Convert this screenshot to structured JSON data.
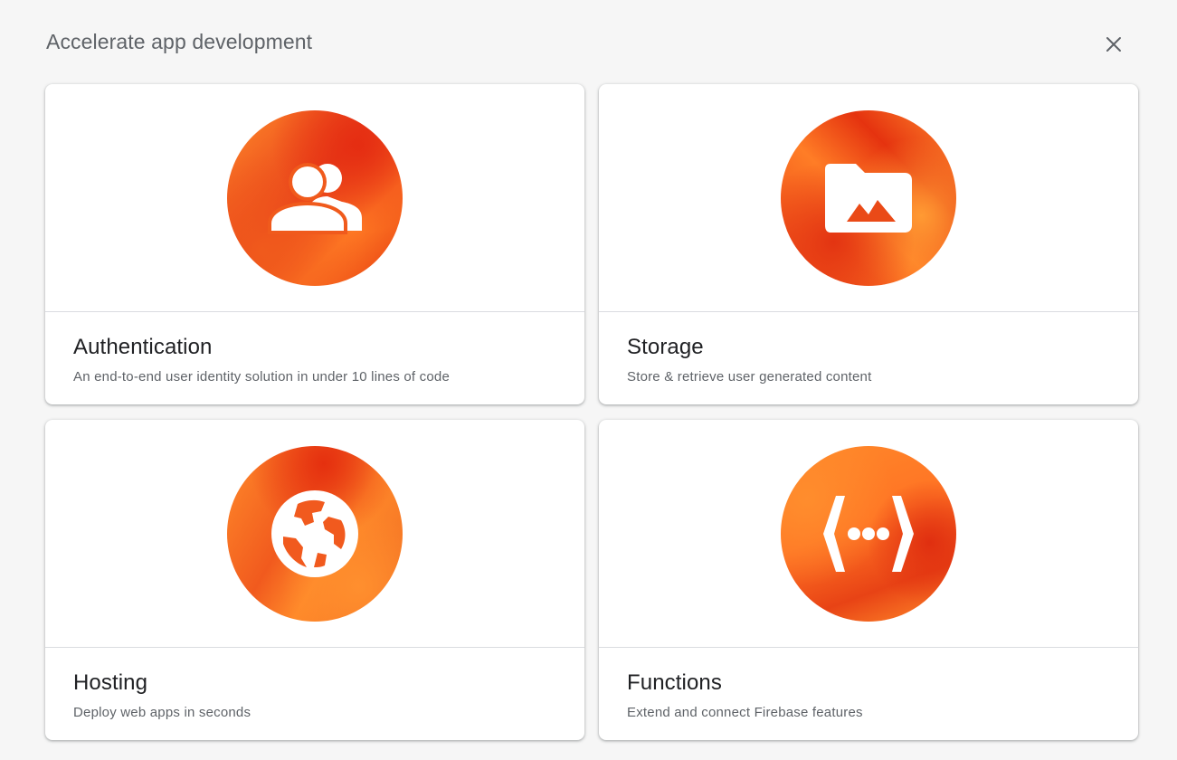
{
  "header": {
    "title": "Accelerate app development",
    "close_icon": "close-icon"
  },
  "cards": [
    {
      "title": "Authentication",
      "description": "An end-to-end user identity solution in under 10 lines of code",
      "icon": "people-icon"
    },
    {
      "title": "Storage",
      "description": "Store & retrieve user generated content",
      "icon": "folder-image-icon"
    },
    {
      "title": "Hosting",
      "description": "Deploy web apps in seconds",
      "icon": "globe-icon"
    },
    {
      "title": "Functions",
      "description": "Extend and connect Firebase features",
      "icon": "functions-icon"
    }
  ],
  "colors": {
    "accent_orange": "#ff7a24",
    "accent_red": "#e5330f",
    "background": "#f6f6f6"
  }
}
